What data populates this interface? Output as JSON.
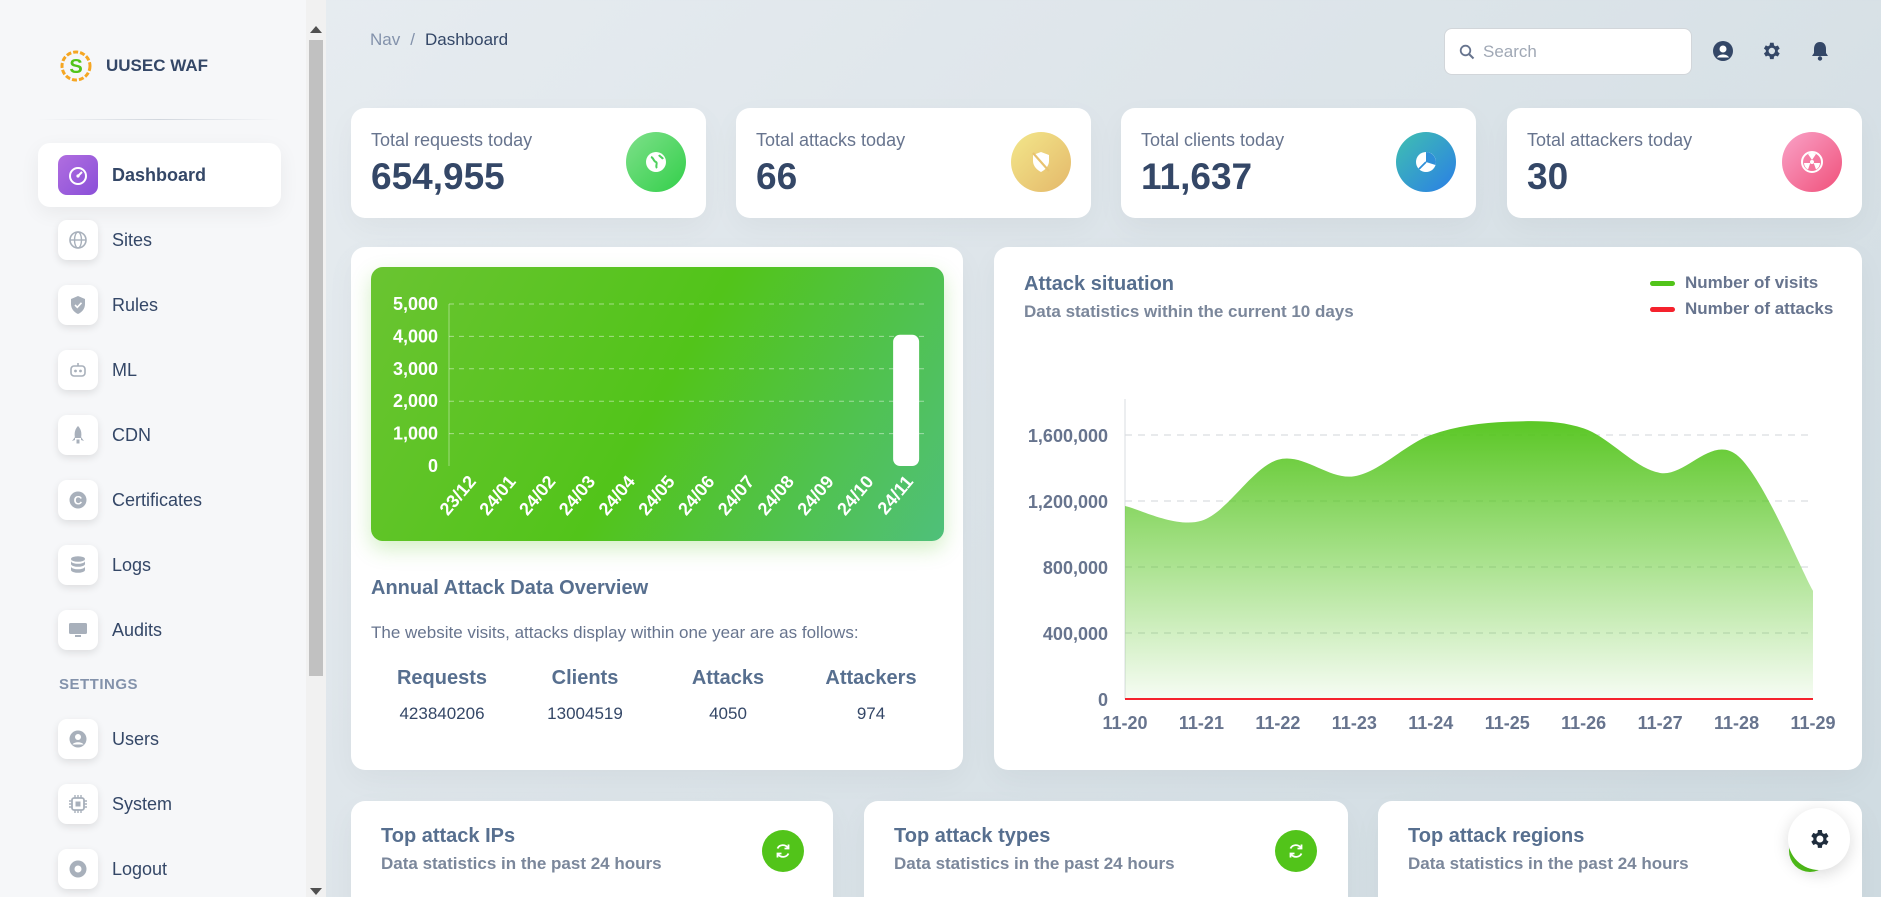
{
  "brand": {
    "name": "UUSEC WAF"
  },
  "sidebar": {
    "items": [
      {
        "label": "Dashboard",
        "icon": "dashboard-icon",
        "active": true
      },
      {
        "label": "Sites",
        "icon": "globe-icon"
      },
      {
        "label": "Rules",
        "icon": "shield-icon"
      },
      {
        "label": "ML",
        "icon": "robot-icon"
      },
      {
        "label": "CDN",
        "icon": "rocket-icon"
      },
      {
        "label": "Certificates",
        "icon": "certificate-icon"
      },
      {
        "label": "Logs",
        "icon": "database-icon"
      },
      {
        "label": "Audits",
        "icon": "monitor-icon"
      }
    ],
    "settings_heading": "SETTINGS",
    "settings_items": [
      {
        "label": "Users",
        "icon": "user-icon"
      },
      {
        "label": "System",
        "icon": "chip-icon"
      },
      {
        "label": "Logout",
        "icon": "logout-icon"
      }
    ]
  },
  "header": {
    "breadcrumb": {
      "root": "Nav",
      "separator": "/",
      "current": "Dashboard"
    },
    "search": {
      "placeholder": "Search",
      "value": ""
    },
    "icons": [
      "account-icon",
      "gear-icon",
      "bell-icon"
    ]
  },
  "stats": [
    {
      "title": "Total requests today",
      "value": "654,955",
      "icon": "globe-icon",
      "gradient": [
        "#7ee08a",
        "#33cf4a"
      ]
    },
    {
      "title": "Total attacks today",
      "value": "66",
      "icon": "shield-off-icon",
      "gradient": [
        "#f3e78b",
        "#e4b86a"
      ]
    },
    {
      "title": "Total clients today",
      "value": "11,637",
      "icon": "pie-chart-icon",
      "gradient": [
        "#40c0b0",
        "#2a7ee6"
      ]
    },
    {
      "title": "Total attackers today",
      "value": "30",
      "icon": "radiation-icon",
      "gradient": [
        "#f9a3c8",
        "#f0507a"
      ]
    }
  ],
  "annual": {
    "title": "Annual Attack Data Overview",
    "description": "The website visits, attacks display within one year are as follows:",
    "columns": [
      {
        "label": "Requests",
        "value": "423840206"
      },
      {
        "label": "Clients",
        "value": "13004519"
      },
      {
        "label": "Attacks",
        "value": "4050"
      },
      {
        "label": "Attackers",
        "value": "974"
      }
    ]
  },
  "chart_data": [
    {
      "type": "bar",
      "title": "",
      "categories": [
        "23/12",
        "24/01",
        "24/02",
        "24/03",
        "24/04",
        "24/05",
        "24/06",
        "24/07",
        "24/08",
        "24/09",
        "24/10",
        "24/11"
      ],
      "values": [
        0,
        0,
        0,
        0,
        0,
        0,
        0,
        0,
        0,
        0,
        0,
        4050
      ],
      "ylim": [
        0,
        5000
      ],
      "yticks": [
        "5,000",
        "4,000",
        "3,000",
        "2,000",
        "1,000",
        "0"
      ],
      "grid": true,
      "bar_color": "#ffffff"
    },
    {
      "type": "area",
      "title": "Attack situation",
      "subtitle": "Data statistics within the current 10 days",
      "x": [
        "11-20",
        "11-21",
        "11-22",
        "11-23",
        "11-24",
        "11-25",
        "11-26",
        "11-27",
        "11-28",
        "11-29"
      ],
      "series": [
        {
          "name": "Number of visits",
          "color": "#52c41a",
          "values": [
            1170000,
            1080000,
            1450000,
            1350000,
            1600000,
            1680000,
            1640000,
            1370000,
            1480000,
            654955
          ]
        },
        {
          "name": "Number of attacks",
          "color": "#f5222d",
          "values": [
            5,
            8,
            6,
            7,
            4,
            10,
            9,
            6,
            5,
            66
          ]
        }
      ],
      "ylim": [
        0,
        1800000
      ],
      "yticks": [
        "1,600,000",
        "1,200,000",
        "800,000",
        "400,000",
        "0"
      ],
      "grid": true,
      "legend": "top-right"
    }
  ],
  "bottom_cards": [
    {
      "title": "Top attack IPs",
      "subtitle": "Data statistics in the past 24 hours"
    },
    {
      "title": "Top attack types",
      "subtitle": "Data statistics in the past 24 hours"
    },
    {
      "title": "Top attack regions",
      "subtitle": "Data statistics in the past 24 hours"
    }
  ]
}
